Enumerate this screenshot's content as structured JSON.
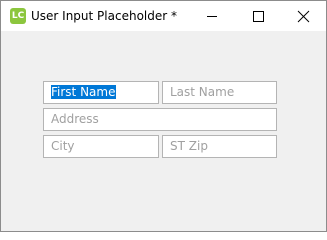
{
  "window": {
    "title": "User Input Placeholder *",
    "app_icon_text": "LC",
    "icons": {
      "minimize": "minimize-icon",
      "maximize": "maximize-icon",
      "close": "close-icon"
    }
  },
  "form": {
    "first_name": {
      "value": "First Name",
      "selected": true
    },
    "last_name": {
      "placeholder": "Last Name"
    },
    "address": {
      "placeholder": "Address"
    },
    "city": {
      "placeholder": "City"
    },
    "st_zip": {
      "placeholder": "ST Zip"
    }
  },
  "colors": {
    "selection": "#0078d7",
    "app_icon": "#8cc63e",
    "placeholder_text": "#a0a0a0"
  }
}
